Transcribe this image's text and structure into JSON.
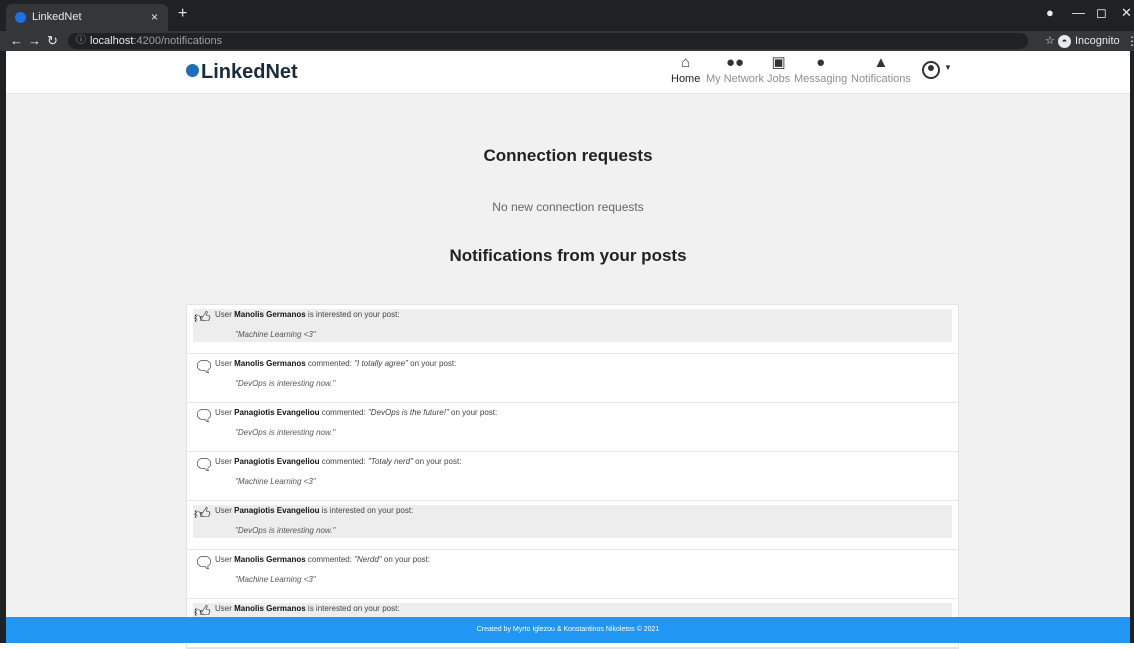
{
  "browser": {
    "tab_title": "LinkedNet",
    "tab_close": "×",
    "new_tab": "+",
    "url_host": "localhost",
    "url_path": ":4200/notifications",
    "incognito_label": "Incognito",
    "window_controls": [
      "—",
      "◻",
      "✕"
    ]
  },
  "header": {
    "brand": "LinkedNet",
    "nav": [
      {
        "label": "Home",
        "icon": "home-icon",
        "active": true
      },
      {
        "label": "My Network",
        "icon": "network-icon",
        "active": false
      },
      {
        "label": "Jobs",
        "icon": "briefcase-icon",
        "active": false
      },
      {
        "label": "Messaging",
        "icon": "chat-icon",
        "active": false
      },
      {
        "label": "Notifications",
        "icon": "bell-icon",
        "active": false
      }
    ]
  },
  "main": {
    "connection_title": "Connection requests",
    "connection_empty": "No new connection requests",
    "notifications_title": "Notifications from your posts",
    "notifications": [
      {
        "type": "like",
        "prefix": "User ",
        "user": "Manolis Germanos",
        "middle": " is interested on your post:",
        "comment": "",
        "suffix": "",
        "post": "\"Machine Learning <3\""
      },
      {
        "type": "comment",
        "prefix": "User ",
        "user": "Manolis Germanos",
        "middle": " commented: ",
        "comment": "\"I totally agree\"",
        "suffix": " on your post:",
        "post": "\"DevOps is interesting now.\""
      },
      {
        "type": "comment",
        "prefix": "User ",
        "user": "Panagiotis Evangeliou",
        "middle": " commented: ",
        "comment": "\"DevOps is the future!\"",
        "suffix": " on your post:",
        "post": "\"DevOps is interesting now.\""
      },
      {
        "type": "comment",
        "prefix": "User ",
        "user": "Panagiotis Evangeliou",
        "middle": " commented: ",
        "comment": "\"Totaly nerd\"",
        "suffix": " on your post:",
        "post": "\"Machine Learning <3\""
      },
      {
        "type": "like",
        "prefix": "User ",
        "user": "Panagiotis Evangeliou",
        "middle": " is interested on your post:",
        "comment": "",
        "suffix": "",
        "post": "\"DevOps is interesting now.\""
      },
      {
        "type": "comment",
        "prefix": "User ",
        "user": "Manolis Germanos",
        "middle": " commented: ",
        "comment": "\"Nerdd\"",
        "suffix": " on your post:",
        "post": "\"Machine Learning <3\""
      },
      {
        "type": "like",
        "prefix": "User ",
        "user": "Manolis Germanos",
        "middle": " is interested on your post:",
        "comment": "",
        "suffix": "",
        "post": ""
      }
    ]
  },
  "footer": {
    "text": "Created by Myrto Iglezou & Konstantinos Nikoletos © 2021"
  },
  "colors": {
    "footer_bg": "#2196f3",
    "page_bg": "#f1f1f1",
    "brand_dot": "#1d6fb8"
  }
}
